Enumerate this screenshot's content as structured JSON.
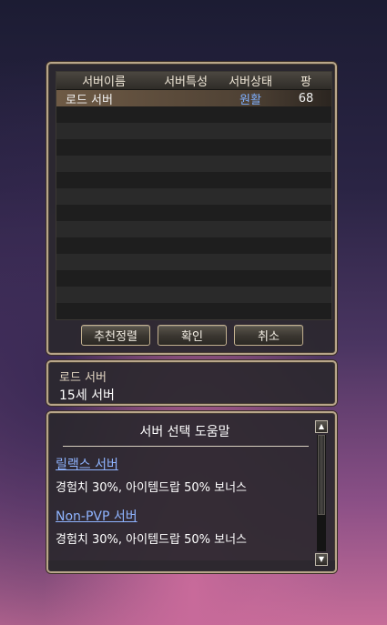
{
  "server_list": {
    "headers": [
      "서버이름",
      "서버특성",
      "서버상태",
      "팡"
    ],
    "rows": [
      {
        "name": "로드 서버",
        "feature": "",
        "status": "원활",
        "count": "68"
      }
    ]
  },
  "buttons": {
    "sort": "추천정렬",
    "confirm": "확인",
    "cancel": "취소"
  },
  "info": {
    "server_name": "로드 서버",
    "rating": "15세 서버"
  },
  "help": {
    "title": "서버 선택 도움말",
    "items": [
      {
        "title": "릴랙스 서버",
        "desc": "경험치 30%, 아이템드랍 50% 보너스"
      },
      {
        "title": "Non-PVP 서버",
        "desc": "경험치 30%, 아이템드랍 50% 보너스"
      }
    ]
  },
  "colors": {
    "status_green": "#7fb0ff",
    "link": "#8fb4ff",
    "panel_border": "#b8a68a"
  }
}
